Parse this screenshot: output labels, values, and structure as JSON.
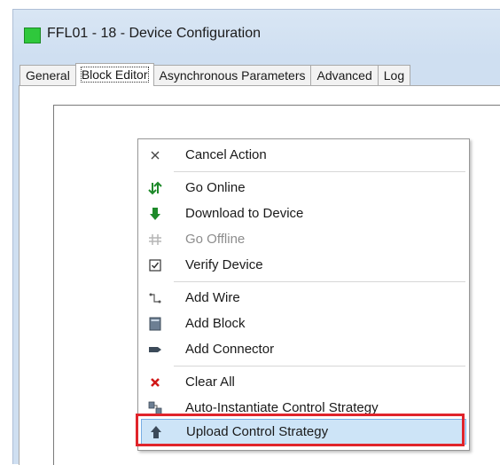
{
  "window": {
    "title": "FFL01 - 18 - Device Configuration",
    "title_icon": "green-square-icon"
  },
  "tabs": [
    {
      "label": "General",
      "active": false
    },
    {
      "label": "Block Editor",
      "active": true
    },
    {
      "label": "Asynchronous Parameters",
      "active": false
    },
    {
      "label": "Advanced",
      "active": false
    },
    {
      "label": "Log",
      "active": false
    }
  ],
  "context_menu": {
    "items": [
      {
        "label": "Cancel Action",
        "icon": "close-icon",
        "disabled": false
      },
      {
        "label": "Go Online",
        "icon": "go-online-icon",
        "disabled": false
      },
      {
        "label": "Download to Device",
        "icon": "download-arrow-icon",
        "disabled": false
      },
      {
        "label": "Go Offline",
        "icon": "go-offline-icon",
        "disabled": true
      },
      {
        "label": "Verify Device",
        "icon": "checkbox-icon",
        "disabled": false
      },
      {
        "label": "Add Wire",
        "icon": "wire-icon",
        "disabled": false
      },
      {
        "label": "Add Block",
        "icon": "block-icon",
        "disabled": false
      },
      {
        "label": "Add Connector",
        "icon": "connector-icon",
        "disabled": false
      },
      {
        "label": "Clear All",
        "icon": "red-x-icon",
        "disabled": false
      },
      {
        "label": "Auto-Instantiate Control Strategy",
        "icon": "auto-instantiate-icon",
        "disabled": false
      },
      {
        "label": "Upload Control Strategy",
        "icon": "upload-arrow-icon",
        "disabled": false,
        "highlighted": true
      }
    ]
  },
  "colors": {
    "callout_border": "#e0242b",
    "highlight_bg": "#cde4f7",
    "title_icon": "#2fc83c"
  }
}
